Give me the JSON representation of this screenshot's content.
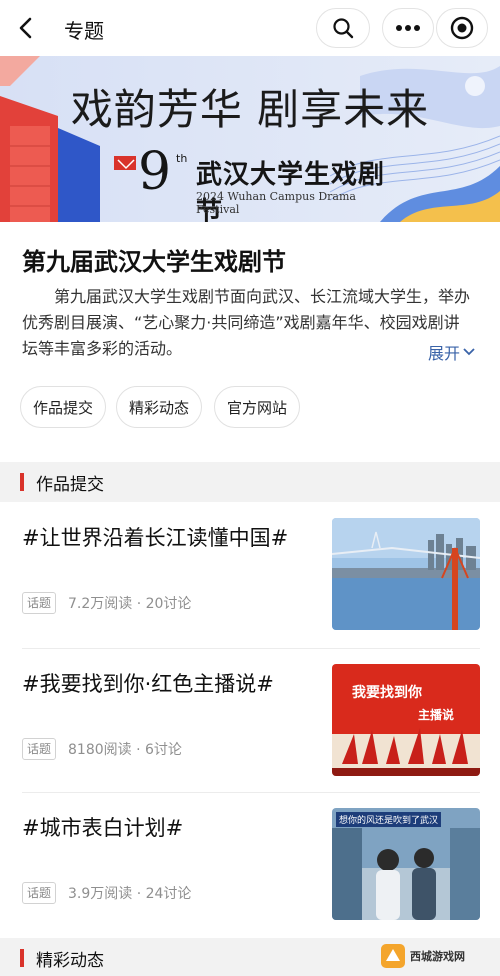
{
  "nav": {
    "title": "专题",
    "back_icon": "chevron-left-icon",
    "search_icon": "search-icon",
    "more_icon": "more-dots-icon",
    "record_icon": "target-icon"
  },
  "banner": {
    "slogan": "戏韵芳华 剧享未来",
    "edition_number": "9",
    "edition_suffix": "th",
    "festival_name": "武汉大学生戏剧节",
    "festival_en": "2024 Wuhan Campus Drama Festival"
  },
  "topic": {
    "title": "第九届武汉大学生戏剧节",
    "description": "第九届武汉大学生戏剧节面向武汉、长江流域大学生，举办优秀剧目展演、“艺心聚力·共同缔造”戏剧嘉年华、校园戏剧讲坛等丰富多彩的活动。",
    "expand_label": "展开"
  },
  "chips": [
    "作品提交",
    "精彩动态",
    "官方网站"
  ],
  "sections": [
    {
      "title": "作品提交",
      "posts": [
        {
          "title": "#让世界沿着长江读懂中国#",
          "tag": "话题",
          "meta": "7.2万阅读 · 20讨论",
          "thumb": "bridge-river-photo"
        },
        {
          "title": "#我要找到你·红色主播说#",
          "tag": "话题",
          "meta": "8180阅读 · 6讨论",
          "thumb": "red-poster-image",
          "thumb_text": "我要找到你",
          "thumb_text2": "主播说"
        },
        {
          "title": "#城市表白计划#",
          "tag": "话题",
          "meta": "3.9万阅读 · 24讨论",
          "thumb": "couple-street-photo",
          "thumb_text": "想你的风还是吹到了武汉"
        }
      ]
    },
    {
      "title": "精彩动态"
    }
  ],
  "watermark": {
    "text": "西城游戏网"
  },
  "colors": {
    "accent_red": "#d9332b",
    "link_blue": "#3a63a8",
    "section_bg": "#f2f2f2"
  }
}
